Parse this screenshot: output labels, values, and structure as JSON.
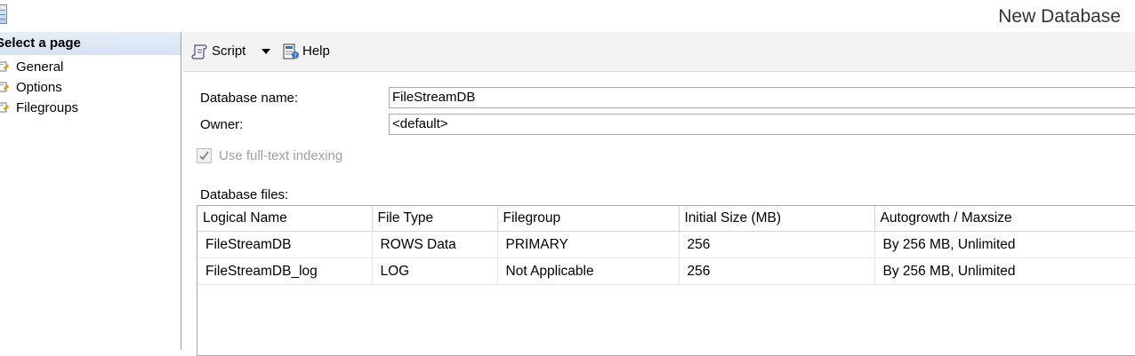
{
  "window": {
    "title": "New Database",
    "icon": "database-window-icon"
  },
  "left_pane": {
    "header": "Select a page",
    "items": [
      {
        "label": "General",
        "icon": "page-wrench-icon"
      },
      {
        "label": "Options",
        "icon": "page-wrench-icon"
      },
      {
        "label": "Filegroups",
        "icon": "page-wrench-icon"
      }
    ]
  },
  "toolbar": {
    "script_label": "Script",
    "help_label": "Help"
  },
  "form": {
    "database_name_label": "Database name:",
    "database_name_value": "FileStreamDB",
    "owner_label": "Owner:",
    "owner_value": "<default>",
    "fulltext_label": "Use full-text indexing",
    "fulltext_checked": true
  },
  "files": {
    "label": "Database files:",
    "columns": [
      "Logical Name",
      "File Type",
      "Filegroup",
      "Initial Size (MB)",
      "Autogrowth / Maxsize"
    ],
    "rows": [
      [
        "FileStreamDB",
        "ROWS Data",
        "PRIMARY",
        "256",
        "By 256 MB, Unlimited"
      ],
      [
        "FileStreamDB_log",
        "LOG",
        "Not Applicable",
        "256",
        "By 256 MB, Unlimited"
      ]
    ]
  }
}
